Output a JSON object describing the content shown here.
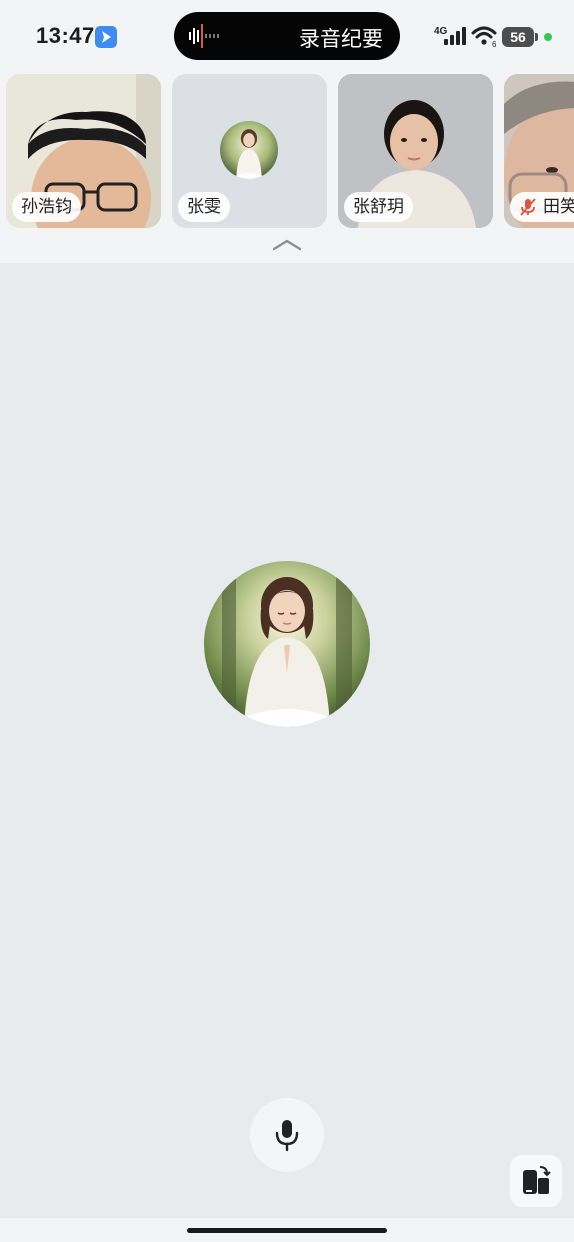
{
  "status_bar": {
    "time": "13:47",
    "island_label": "录音纪要",
    "network": "4G",
    "wifi_sub": "6",
    "battery": "56",
    "icons": [
      "app-shortcut-icon",
      "waveform-icon",
      "cellular-signal-icon",
      "wifi-icon",
      "battery-icon",
      "mic-in-use-dot"
    ]
  },
  "participants": [
    {
      "name": "孙浩钧",
      "muted": false,
      "camera": true
    },
    {
      "name": "张雯",
      "muted": false,
      "camera": false
    },
    {
      "name": "张舒玥",
      "muted": false,
      "camera": true
    },
    {
      "name": "田笑",
      "muted": true,
      "camera": true
    }
  ],
  "controls": {
    "collapse_icon": "chevron-up-icon",
    "mic_icon": "microphone-icon",
    "switch_icon": "device-switch-icon"
  },
  "colors": {
    "background": "#e8ebee",
    "muted_red": "#e0533d",
    "island": "#050505"
  }
}
